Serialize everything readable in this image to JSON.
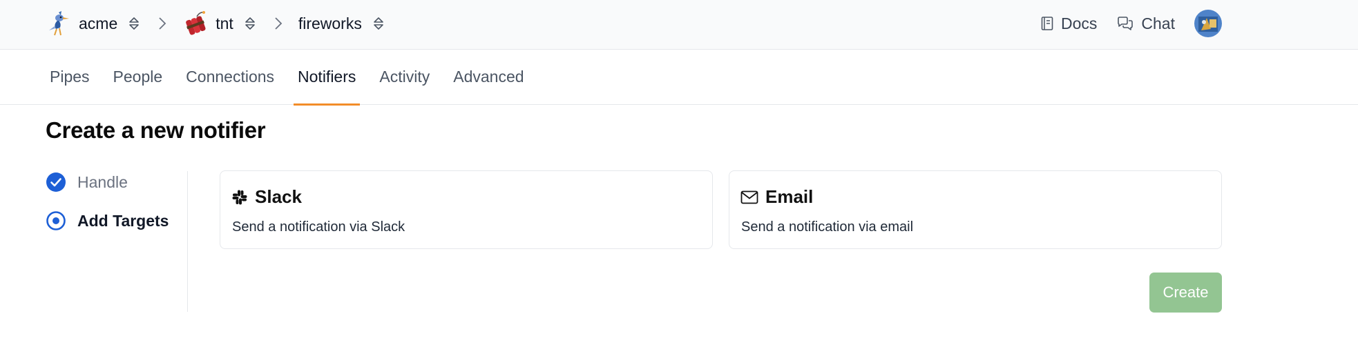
{
  "breadcrumb": {
    "org": "acme",
    "project": "tnt",
    "environment": "fireworks"
  },
  "header": {
    "docs_label": "Docs",
    "chat_label": "Chat"
  },
  "tabs": [
    {
      "label": "Pipes",
      "active": false
    },
    {
      "label": "People",
      "active": false
    },
    {
      "label": "Connections",
      "active": false
    },
    {
      "label": "Notifiers",
      "active": true
    },
    {
      "label": "Activity",
      "active": false
    },
    {
      "label": "Advanced",
      "active": false
    }
  ],
  "page": {
    "title": "Create a new notifier"
  },
  "steps": [
    {
      "label": "Handle",
      "status": "complete"
    },
    {
      "label": "Add Targets",
      "status": "current"
    }
  ],
  "targets": [
    {
      "icon": "slack-icon",
      "title": "Slack",
      "description": "Send a notification via Slack"
    },
    {
      "icon": "envelope-icon",
      "title": "Email",
      "description": "Send a notification via email"
    }
  ],
  "actions": {
    "create_label": "Create"
  },
  "colors": {
    "accent_tab": "#f28c28",
    "step_blue": "#1d5fd6",
    "create_button": "#93c592"
  }
}
